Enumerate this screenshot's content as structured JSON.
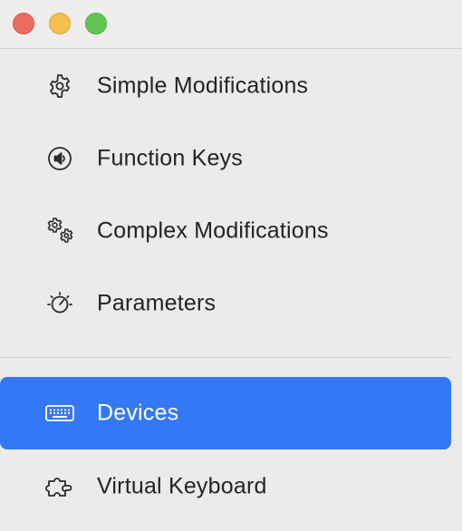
{
  "window": {
    "controls": {
      "close_icon": "close-circle",
      "minimize_icon": "minimize-circle",
      "zoom_icon": "zoom-circle"
    }
  },
  "sidebar": {
    "items": [
      {
        "label": "Simple Modifications",
        "icon": "gear-icon"
      },
      {
        "label": "Function Keys",
        "icon": "speaker-circle-icon"
      },
      {
        "label": "Complex Modifications",
        "icon": "gears-icon"
      },
      {
        "label": "Parameters",
        "icon": "gauge-icon"
      },
      {
        "label": "Devices",
        "icon": "keyboard-icon",
        "selected": true
      },
      {
        "label": "Virtual Keyboard",
        "icon": "puzzle-icon"
      }
    ]
  },
  "colors": {
    "accent": "#3478f6",
    "background": "#ecebea",
    "text": "#232323"
  }
}
